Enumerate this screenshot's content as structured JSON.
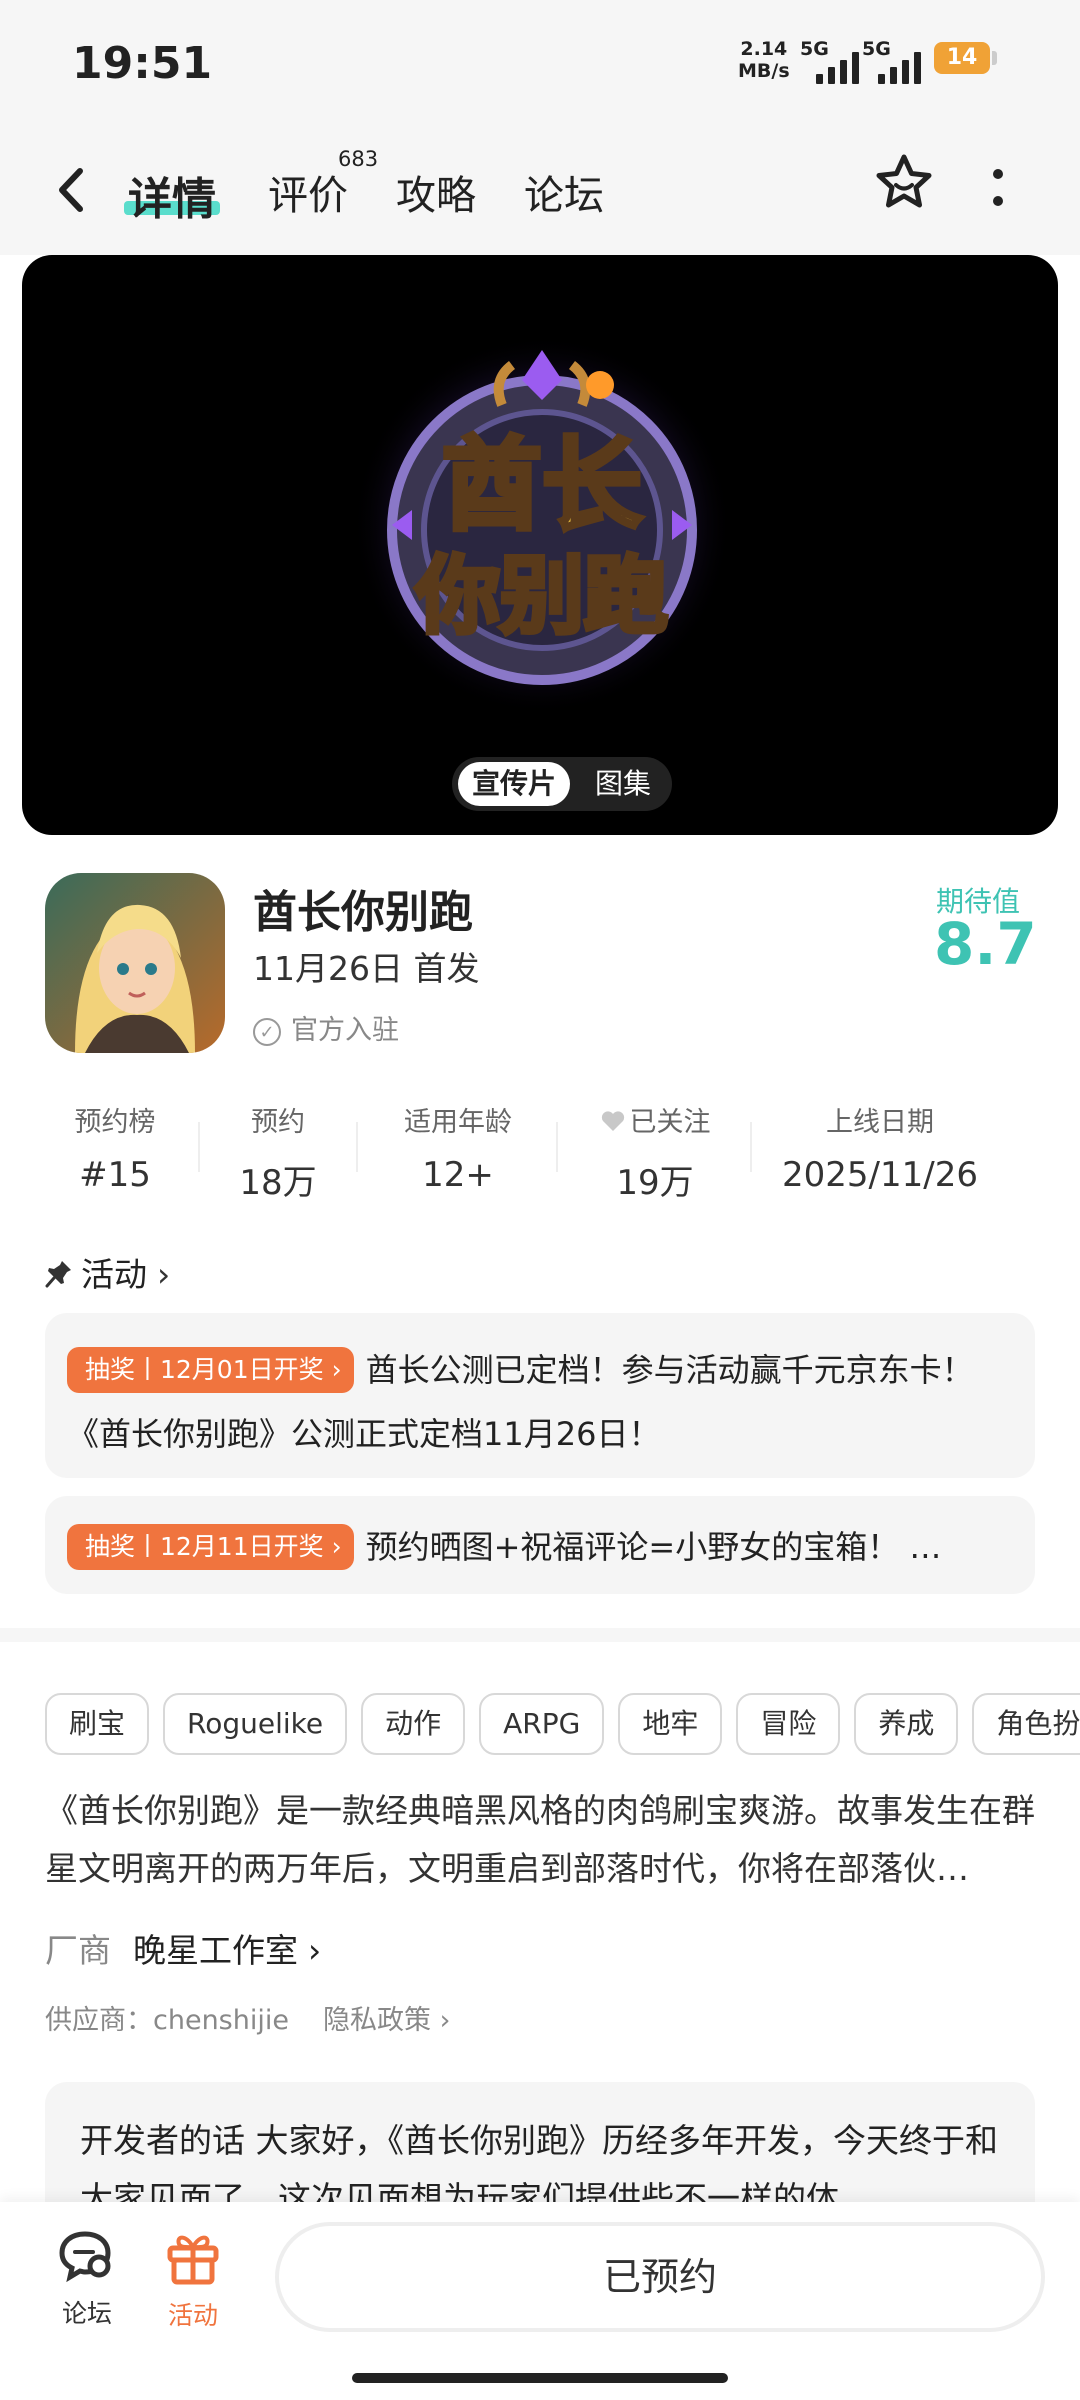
{
  "status_bar": {
    "time": "19:51",
    "net_speed_value": "2.14",
    "net_speed_unit": "MB/s",
    "signal1_label": "5G",
    "signal2_label": "5G",
    "battery": "14"
  },
  "nav": {
    "tabs": [
      {
        "label": "详情"
      },
      {
        "label": "评价"
      },
      {
        "label": "攻略"
      },
      {
        "label": "论坛"
      }
    ],
    "reviews_count": "683"
  },
  "banner": {
    "logo_text_line1": "酋长",
    "logo_text_line2": "你别跑",
    "media_tabs": [
      "宣传片",
      "图集"
    ]
  },
  "app": {
    "name": "酋长你别跑",
    "release": "11月26日 首发",
    "official": "官方入驻",
    "expect_label": "期待值",
    "expect_score": "8.7"
  },
  "stats": [
    {
      "label": "预约榜",
      "value": "#15"
    },
    {
      "label": "预约",
      "value": "18万"
    },
    {
      "label": "适用年龄",
      "value": "12+"
    },
    {
      "label": "已关注",
      "value": "19万"
    },
    {
      "label": "上线日期",
      "value": "2025/11/26"
    }
  ],
  "activity": {
    "title": "活动",
    "items": [
      {
        "badge": "抽奖丨12月01日开奖",
        "text": "酋长公测已定档！参与活动赢千元京东卡！《酋长你别跑》公测正式定档11月26日！"
      },
      {
        "badge": "抽奖丨12月11日开奖",
        "text": "预约晒图+祝福评论=小野女的宝箱！ …"
      }
    ]
  },
  "tags": [
    "刷宝",
    "Roguelike",
    "动作",
    "ARPG",
    "地牢",
    "冒险",
    "养成",
    "角色扮"
  ],
  "description": "《酋长你别跑》是一款经典暗黑风格的肉鸽刷宝爽游。故事发生在群星文明离开的两万年后，文明重启到部落时代，你将在部落伙…",
  "vendor": {
    "label": "厂商",
    "name": "晚星工作室"
  },
  "supplier": {
    "text": "供应商：chenshijie",
    "privacy": "隐私政策"
  },
  "developer_note": "开发者的话  大家好，《酋长你别跑》历经多年开发，今天终于和大家见面了。这次见面想为玩家们提供些不一样的体",
  "bottom": {
    "forum": "论坛",
    "activity": "活动",
    "reserved": "已预约"
  },
  "colors": {
    "accent_teal": "#3ec3b3",
    "accent_orange": "#f0743e",
    "battery": "#f0a236"
  }
}
